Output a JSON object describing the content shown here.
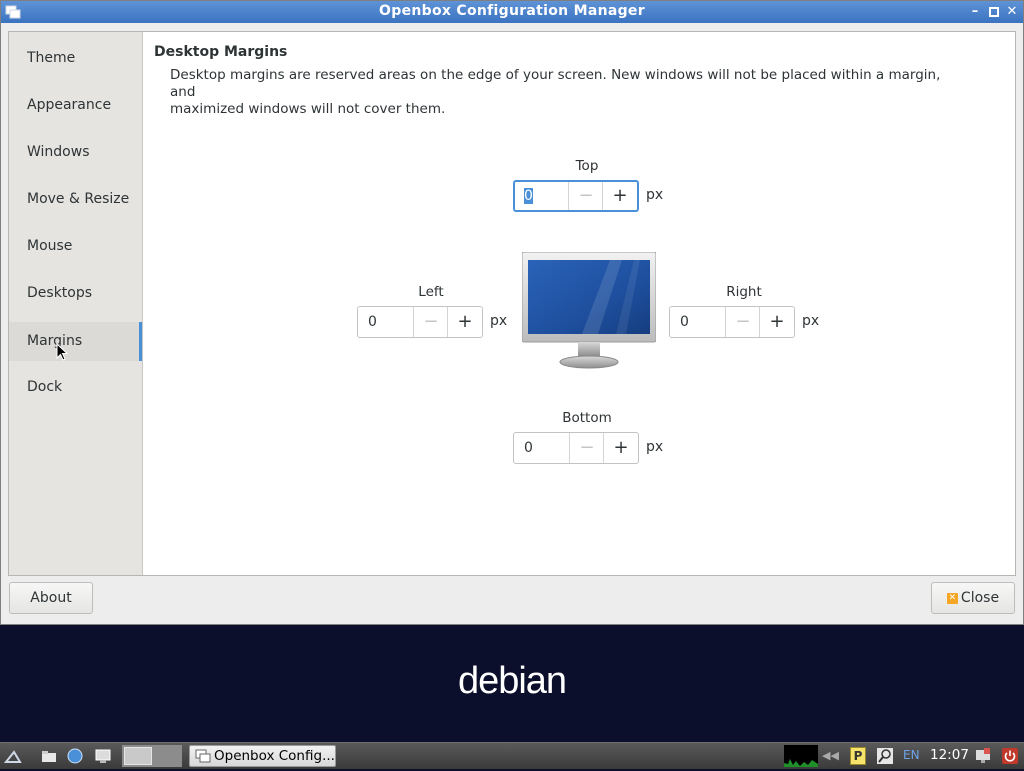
{
  "window": {
    "title": "Openbox Configuration Manager",
    "controls": [
      "minimize",
      "maximize",
      "close"
    ]
  },
  "sidebar": {
    "items": [
      {
        "label": "Theme"
      },
      {
        "label": "Appearance"
      },
      {
        "label": "Windows"
      },
      {
        "label": "Move & Resize"
      },
      {
        "label": "Mouse"
      },
      {
        "label": "Desktops"
      },
      {
        "label": "Margins",
        "selected": true
      },
      {
        "label": "Dock"
      }
    ]
  },
  "main": {
    "heading": "Desktop Margins",
    "description_line1": "Desktop margins are reserved areas on the edge of your screen.  New windows will not be placed within a margin, and",
    "description_line2": "maximized windows will not cover them.",
    "unit": "px",
    "top": {
      "label": "Top",
      "value": "0"
    },
    "left": {
      "label": "Left",
      "value": "0"
    },
    "right": {
      "label": "Right",
      "value": "0"
    },
    "bottom": {
      "label": "Bottom",
      "value": "0"
    },
    "minus_symbol": "−",
    "plus_symbol": "+"
  },
  "footer": {
    "about_label": "About",
    "close_label": "Close"
  },
  "desktop": {
    "logo_text": "debian"
  },
  "taskbar": {
    "task_label": "Openbox Config...",
    "language": "EN",
    "clock": "12:07"
  },
  "colors": {
    "titlebar": "#3b73c1",
    "accent": "#4a90d9",
    "desktop_bg": "#0b0f2b"
  }
}
